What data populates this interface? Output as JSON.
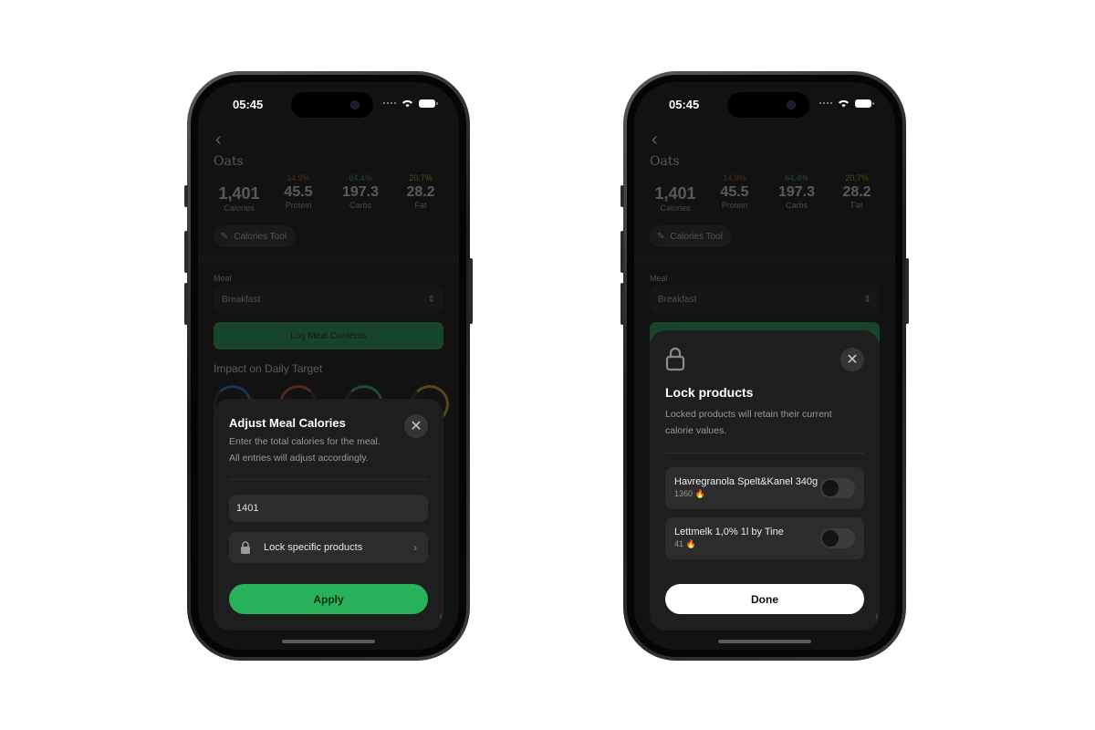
{
  "status": {
    "time": "05:45"
  },
  "background": {
    "title": "Oats",
    "stats": [
      {
        "pct": "",
        "value": "1,401",
        "label": "Calories",
        "pct_color": "#000000"
      },
      {
        "pct": "14.9%",
        "value": "45.5",
        "label": "Protein",
        "pct_color": "#e0553c"
      },
      {
        "pct": "64.4%",
        "value": "197.3",
        "label": "Carbs",
        "pct_color": "#3fc06e"
      },
      {
        "pct": "20.7%",
        "value": "28.2",
        "label": "Fat",
        "pct_color": "#e8b22c"
      }
    ],
    "calories_tool": "Calories Tool",
    "meal_label": "Meal",
    "meal_value": "Breakfast",
    "log_button": "Log Meal Contents",
    "impact_title": "Impact on Daily Target"
  },
  "adjust_sheet": {
    "title": "Adjust Meal Calories",
    "subtitle_line1": "Enter the total calories for the meal.",
    "subtitle_line2": "All entries will adjust accordingly.",
    "calories_value": "1401",
    "lock_row": "Lock specific products",
    "apply": "Apply"
  },
  "lock_sheet": {
    "title": "Lock products",
    "subtitle_line1": "Locked products will retain their current",
    "subtitle_line2": "calorie values.",
    "products": [
      {
        "name": "Havregranola Spelt&Kanel 340g",
        "calories": "1360"
      },
      {
        "name": "Lettmelk 1,0% 1l by Tine",
        "calories": "41"
      }
    ],
    "done": "Done"
  },
  "colors": {
    "accent_green": "#27b25a",
    "sheet_bg": "#1e1e1e",
    "screen_bg": "#121212"
  }
}
